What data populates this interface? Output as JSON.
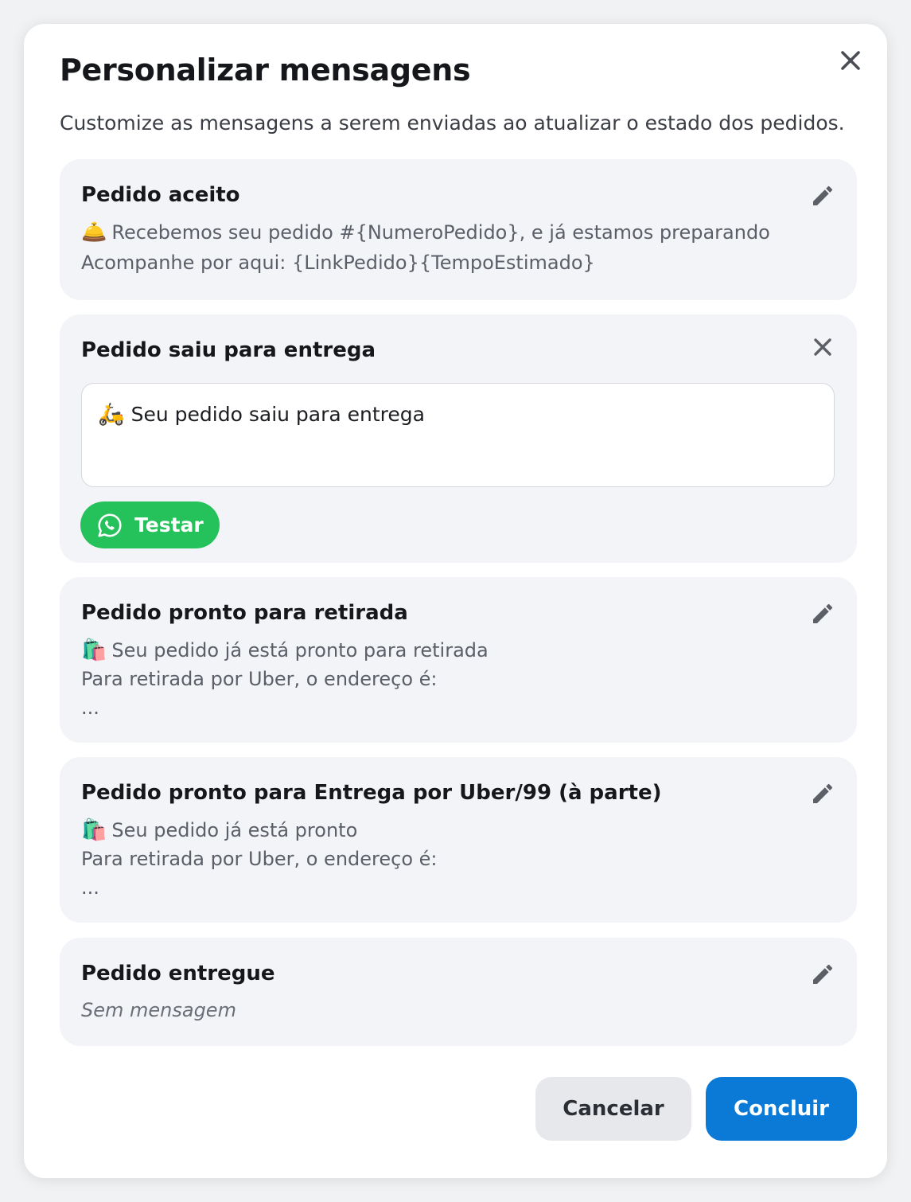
{
  "modal": {
    "title": "Personalizar mensagens",
    "subtitle": "Customize as mensagens a serem enviadas ao atualizar o estado dos pedidos.",
    "close_icon": "close-icon"
  },
  "cards": [
    {
      "title": "Pedido aceito",
      "state": "collapsed",
      "emoji": "🛎️",
      "lines": [
        "Recebemos seu pedido #{NumeroPedido}, e já estamos preparando",
        "Acompanhe por aqui: {LinkPedido}{TempoEstimado}"
      ],
      "action_icon": "pencil-icon"
    },
    {
      "title": "Pedido saiu para entrega",
      "state": "editing",
      "emoji": "🛵",
      "textarea_value": "Seu pedido saiu para entrega",
      "test_button_label": "Testar",
      "test_button_icon": "whatsapp-icon",
      "action_icon": "close-icon"
    },
    {
      "title": "Pedido pronto para retirada",
      "state": "collapsed",
      "emoji": "🛍️",
      "lines": [
        "Seu pedido já está pronto para retirada",
        "Para retirada por Uber, o endereço é:",
        "..."
      ],
      "action_icon": "pencil-icon"
    },
    {
      "title": "Pedido pronto para Entrega por Uber/99 (à parte)",
      "state": "collapsed",
      "emoji": "🛍️",
      "lines": [
        "Seu pedido já está pronto",
        "Para retirada por Uber, o endereço é:",
        "..."
      ],
      "action_icon": "pencil-icon"
    },
    {
      "title": "Pedido entregue",
      "state": "empty",
      "lines": [
        "Sem mensagem"
      ],
      "action_icon": "pencil-icon"
    }
  ],
  "footer": {
    "cancel_label": "Cancelar",
    "confirm_label": "Concluir"
  },
  "colors": {
    "primary": "#0a7ad6",
    "whatsapp": "#25c15b",
    "card_bg": "#f3f4f7"
  }
}
